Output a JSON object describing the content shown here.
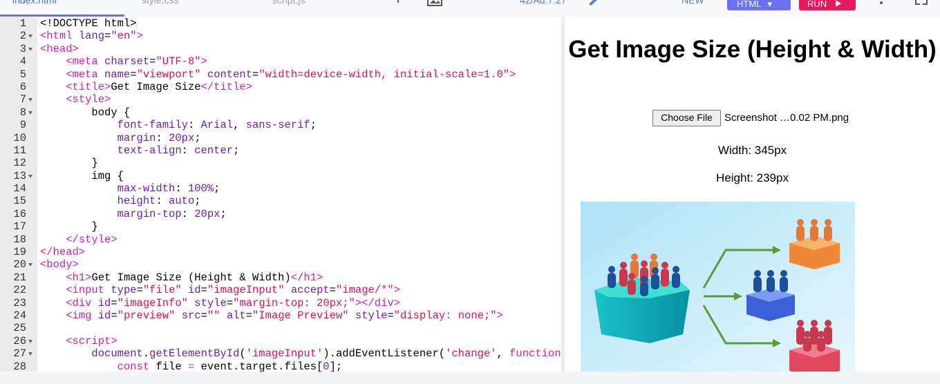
{
  "toolbar": {
    "tabs": [
      {
        "label": "index.html",
        "active": true
      },
      {
        "label": "style.css",
        "active": false
      },
      {
        "label": "script.js",
        "active": false
      }
    ],
    "timer": "42/Ad:7:27",
    "new_label": "NEW",
    "lang_label": "HTML",
    "run_label": "RUN"
  },
  "editor": {
    "lines": [
      {
        "n": "1",
        "fold": false
      },
      {
        "n": "2",
        "fold": true
      },
      {
        "n": "3",
        "fold": true
      },
      {
        "n": "4",
        "fold": false
      },
      {
        "n": "5",
        "fold": false
      },
      {
        "n": "6",
        "fold": false
      },
      {
        "n": "7",
        "fold": true
      },
      {
        "n": "8",
        "fold": true
      },
      {
        "n": "9",
        "fold": false
      },
      {
        "n": "10",
        "fold": false
      },
      {
        "n": "11",
        "fold": false
      },
      {
        "n": "12",
        "fold": false
      },
      {
        "n": "13",
        "fold": true
      },
      {
        "n": "14",
        "fold": false
      },
      {
        "n": "15",
        "fold": false
      },
      {
        "n": "16",
        "fold": false
      },
      {
        "n": "17",
        "fold": false
      },
      {
        "n": "18",
        "fold": false
      },
      {
        "n": "19",
        "fold": false
      },
      {
        "n": "20",
        "fold": true
      },
      {
        "n": "21",
        "fold": false
      },
      {
        "n": "22",
        "fold": false
      },
      {
        "n": "23",
        "fold": false
      },
      {
        "n": "24",
        "fold": false
      },
      {
        "n": "25",
        "fold": false
      },
      {
        "n": "26",
        "fold": true
      },
      {
        "n": "27",
        "fold": true
      },
      {
        "n": "28",
        "fold": false
      }
    ],
    "code": [
      [
        [
          "tx",
          "<!DOCTYPE html>"
        ]
      ],
      [
        [
          "tg",
          "<html "
        ],
        [
          "at",
          "lang"
        ],
        [
          "tx",
          "="
        ],
        [
          "st",
          "\"en\""
        ],
        [
          "tg",
          ">"
        ]
      ],
      [
        [
          "tg",
          "<head>"
        ]
      ],
      [
        [
          "tx",
          "    "
        ],
        [
          "tg",
          "<meta "
        ],
        [
          "at",
          "charset"
        ],
        [
          "tx",
          "="
        ],
        [
          "st",
          "\"UTF-8\""
        ],
        [
          "tg",
          ">"
        ]
      ],
      [
        [
          "tx",
          "    "
        ],
        [
          "tg",
          "<meta "
        ],
        [
          "at",
          "name"
        ],
        [
          "tx",
          "="
        ],
        [
          "st",
          "\"viewport\""
        ],
        [
          "tx",
          " "
        ],
        [
          "at",
          "content"
        ],
        [
          "tx",
          "="
        ],
        [
          "st",
          "\"width=device-width, initial-scale=1.0\""
        ],
        [
          "tg",
          ">"
        ]
      ],
      [
        [
          "tx",
          "    "
        ],
        [
          "tg",
          "<title>"
        ],
        [
          "tx",
          "Get Image Size"
        ],
        [
          "tg",
          "</title>"
        ]
      ],
      [
        [
          "tx",
          "    "
        ],
        [
          "tg",
          "<style>"
        ]
      ],
      [
        [
          "tx",
          "        body {"
        ]
      ],
      [
        [
          "tx",
          "            "
        ],
        [
          "at",
          "font-family"
        ],
        [
          "tx",
          ": "
        ],
        [
          "nu",
          "Arial"
        ],
        [
          "tx",
          ", "
        ],
        [
          "nu",
          "sans-serif"
        ],
        [
          "tx",
          ";"
        ]
      ],
      [
        [
          "tx",
          "            "
        ],
        [
          "at",
          "margin"
        ],
        [
          "tx",
          ": "
        ],
        [
          "nu",
          "20px"
        ],
        [
          "tx",
          ";"
        ]
      ],
      [
        [
          "tx",
          "            "
        ],
        [
          "at",
          "text-align"
        ],
        [
          "tx",
          ": "
        ],
        [
          "nu",
          "center"
        ],
        [
          "tx",
          ";"
        ]
      ],
      [
        [
          "tx",
          "        }"
        ]
      ],
      [
        [
          "tx",
          "        img {"
        ]
      ],
      [
        [
          "tx",
          "            "
        ],
        [
          "at",
          "max-width"
        ],
        [
          "tx",
          ": "
        ],
        [
          "nu",
          "100%"
        ],
        [
          "tx",
          ";"
        ]
      ],
      [
        [
          "tx",
          "            "
        ],
        [
          "at",
          "height"
        ],
        [
          "tx",
          ": "
        ],
        [
          "nu",
          "auto"
        ],
        [
          "tx",
          ";"
        ]
      ],
      [
        [
          "tx",
          "            "
        ],
        [
          "at",
          "margin-top"
        ],
        [
          "tx",
          ": "
        ],
        [
          "nu",
          "20px"
        ],
        [
          "tx",
          ";"
        ]
      ],
      [
        [
          "tx",
          "        }"
        ]
      ],
      [
        [
          "tx",
          "    "
        ],
        [
          "tg",
          "</style>"
        ]
      ],
      [
        [
          "tg",
          "</head>"
        ]
      ],
      [
        [
          "tg",
          "<body>"
        ]
      ],
      [
        [
          "tx",
          "    "
        ],
        [
          "tg",
          "<h1>"
        ],
        [
          "tx",
          "Get Image Size (Height & Width)"
        ],
        [
          "tg",
          "</h1>"
        ]
      ],
      [
        [
          "tx",
          "    "
        ],
        [
          "tg",
          "<input "
        ],
        [
          "at",
          "type"
        ],
        [
          "tx",
          "="
        ],
        [
          "st",
          "\"file\""
        ],
        [
          "tx",
          " "
        ],
        [
          "at",
          "id"
        ],
        [
          "tx",
          "="
        ],
        [
          "st",
          "\"imageInput\""
        ],
        [
          "tx",
          " "
        ],
        [
          "at",
          "accept"
        ],
        [
          "tx",
          "="
        ],
        [
          "st",
          "\"image/*\""
        ],
        [
          "tg",
          ">"
        ]
      ],
      [
        [
          "tx",
          "    "
        ],
        [
          "tg",
          "<div "
        ],
        [
          "at",
          "id"
        ],
        [
          "tx",
          "="
        ],
        [
          "st",
          "\"imageInfo\""
        ],
        [
          "tx",
          " "
        ],
        [
          "at",
          "style"
        ],
        [
          "tx",
          "="
        ],
        [
          "st",
          "\"margin-top: 20px;\""
        ],
        [
          "tg",
          "></div>"
        ]
      ],
      [
        [
          "tx",
          "    "
        ],
        [
          "tg",
          "<img "
        ],
        [
          "at",
          "id"
        ],
        [
          "tx",
          "="
        ],
        [
          "st",
          "\"preview\""
        ],
        [
          "tx",
          " "
        ],
        [
          "at",
          "src"
        ],
        [
          "tx",
          "="
        ],
        [
          "st",
          "\"\""
        ],
        [
          "tx",
          " "
        ],
        [
          "at",
          "alt"
        ],
        [
          "tx",
          "="
        ],
        [
          "st",
          "\"Image Preview\""
        ],
        [
          "tx",
          " "
        ],
        [
          "at",
          "style"
        ],
        [
          "tx",
          "="
        ],
        [
          "st",
          "\"display: none;\""
        ],
        [
          "tg",
          ">"
        ]
      ],
      [
        [
          "tx",
          ""
        ]
      ],
      [
        [
          "tx",
          "    "
        ],
        [
          "tg",
          "<script>"
        ]
      ],
      [
        [
          "tx",
          "        "
        ],
        [
          "fn",
          "document"
        ],
        [
          "tx",
          "."
        ],
        [
          "fn",
          "getElementById"
        ],
        [
          "tx",
          "("
        ],
        [
          "st",
          "'imageInput'"
        ],
        [
          "tx",
          ")."
        ],
        [
          "tx",
          "addEventListener("
        ],
        [
          "st",
          "'change'"
        ],
        [
          "tx",
          ", "
        ],
        [
          "kw",
          "function"
        ]
      ],
      [
        [
          "tx",
          "            "
        ],
        [
          "kw",
          "const"
        ],
        [
          "tx",
          " file "
        ],
        [
          "kw",
          "="
        ],
        [
          "tx",
          " event.target.files["
        ],
        [
          "nu",
          "0"
        ],
        [
          "tx",
          "];"
        ]
      ]
    ]
  },
  "preview": {
    "title": "Get Image Size (Height & Width)",
    "choose_file_label": "Choose File",
    "file_name": "Screenshot …0.02 PM.png",
    "width_text": "Width: 345px",
    "height_text": "Height: 239px"
  }
}
